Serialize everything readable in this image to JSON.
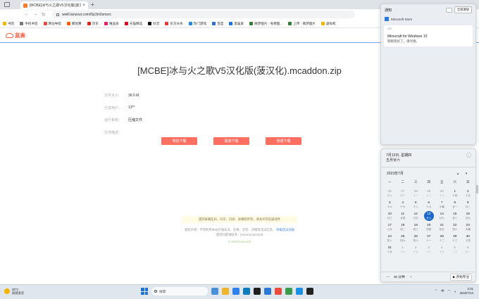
{
  "browser": {
    "tab_title": "[MCBE]冰与火之歌V5汉化版(菠汉化...",
    "tab_close": "×",
    "new_tab": "+",
    "url": "wwill.lanzout.com/i5p3m0smsrc",
    "back": "←",
    "forward": "→",
    "reload": "↻",
    "bookmarks": [
      {
        "label": "书签",
        "color": "#f4b400"
      },
      {
        "label": "手机书签",
        "color": "#777777"
      },
      {
        "label": "网址导航",
        "color": "#e84b3c"
      },
      {
        "label": "聚划算",
        "color": "#ff5a00"
      },
      {
        "label": "京东",
        "color": "#e1251b"
      },
      {
        "label": "唯品会",
        "color": "#e91e63"
      },
      {
        "label": "天猫精选",
        "color": "#d6001c"
      },
      {
        "label": "抖音",
        "color": "#111111"
      },
      {
        "label": "东方头条",
        "color": "#e53935"
      },
      {
        "label": "热门游戏",
        "color": "#1e88e5"
      },
      {
        "label": "百度",
        "color": "#2b6fd6"
      },
      {
        "label": "黑鲨屏",
        "color": "#1a73e8"
      },
      {
        "label": "微梦图片 · 免费图...",
        "color": "#2e7d32"
      },
      {
        "label": "上传 · 微梦图片",
        "color": "#2e7d32"
      },
      {
        "label": "虚拟机",
        "color": "#f4b400"
      }
    ]
  },
  "site": {
    "logo_text": "蓝奏",
    "file_title": "[MCBE]冰与火之歌V5汉化版(菠汉化).mcaddon.zip",
    "info": [
      {
        "label": "文件大小：",
        "value": "36.0 M"
      },
      {
        "label": "分享用户：",
        "value": "13**"
      },
      {
        "label": "运行系统：",
        "value": "压缩文件"
      },
      {
        "label": "文件描述：",
        "value": ""
      }
    ],
    "download_buttons": [
      "电信下载",
      "联通下载",
      "普通下载"
    ],
    "footer_note": "遇到屏幕乱码、闪页、白屏、屏幕假死等，请关闭浏览器插件",
    "footer_line1": "版权声明：不得利用本站存储非法、涉黄、涉恐、涉赌等违法信息。",
    "footer_link": "举报违法违规",
    "footer_line2": "遇到问题请联系：[email protected]",
    "copyright": "© 2023 Lanzou.li"
  },
  "notifications": {
    "title": "通知",
    "clear_all": "全部清除",
    "app": "Microsoft Store",
    "time": "1分",
    "card_title": "Minecraft for Windows 10",
    "card_body": "刚刚装好了，请尽情。"
  },
  "calendar": {
    "date_line1": "7月13日, 星期四",
    "date_line2": "五月廿六",
    "collapse": "⌄",
    "month": "2023年7月",
    "prev": "▲",
    "next": "▼",
    "weekdays": [
      "一",
      "二",
      "三",
      "四",
      "五",
      "六",
      "日"
    ],
    "weeks": [
      [
        {
          "d": "26",
          "s": "初九",
          "o": true
        },
        {
          "d": "27",
          "s": "初十",
          "o": true
        },
        {
          "d": "28",
          "s": "十一",
          "o": true
        },
        {
          "d": "29",
          "s": "十二",
          "o": true
        },
        {
          "d": "30",
          "s": "十三",
          "o": true
        },
        {
          "d": "1",
          "s": "十四"
        },
        {
          "d": "2",
          "s": "十五"
        }
      ],
      [
        {
          "d": "3",
          "s": "十六"
        },
        {
          "d": "4",
          "s": "十七"
        },
        {
          "d": "5",
          "s": "十八"
        },
        {
          "d": "6",
          "s": "十九"
        },
        {
          "d": "7",
          "s": "小暑"
        },
        {
          "d": "8",
          "s": "廿一"
        },
        {
          "d": "9",
          "s": "廿二"
        }
      ],
      [
        {
          "d": "10",
          "s": "廿三"
        },
        {
          "d": "11",
          "s": "廿四"
        },
        {
          "d": "12",
          "s": "廿五"
        },
        {
          "d": "13",
          "s": "廿六",
          "t": true
        },
        {
          "d": "14",
          "s": "廿七"
        },
        {
          "d": "15",
          "s": "廿八"
        },
        {
          "d": "16",
          "s": "廿九"
        }
      ],
      [
        {
          "d": "17",
          "s": "六月"
        },
        {
          "d": "18",
          "s": "初二"
        },
        {
          "d": "19",
          "s": "初三"
        },
        {
          "d": "20",
          "s": "初四"
        },
        {
          "d": "21",
          "s": "初五"
        },
        {
          "d": "22",
          "s": "初六"
        },
        {
          "d": "23",
          "s": "大暑"
        }
      ],
      [
        {
          "d": "24",
          "s": "初八"
        },
        {
          "d": "25",
          "s": "初九"
        },
        {
          "d": "26",
          "s": "初十"
        },
        {
          "d": "27",
          "s": "十一"
        },
        {
          "d": "28",
          "s": "十二"
        },
        {
          "d": "29",
          "s": "十三"
        },
        {
          "d": "30",
          "s": "十四"
        }
      ],
      [
        {
          "d": "31",
          "s": "十五"
        },
        {
          "d": "1",
          "s": "十六",
          "o": true
        },
        {
          "d": "2",
          "s": "十七",
          "o": true
        },
        {
          "d": "3",
          "s": "十八",
          "o": true
        },
        {
          "d": "4",
          "s": "十九",
          "o": true
        },
        {
          "d": "5",
          "s": "二十",
          "o": true
        },
        {
          "d": "6",
          "s": "廿一",
          "o": true
        }
      ]
    ],
    "focus_minus": "—",
    "focus_value": "30 分钟",
    "focus_plus": "+",
    "focus_button": "▶ 开始专注"
  },
  "taskbar": {
    "temp": "30°C",
    "weather": "局部多云",
    "search_placeholder": "搜索",
    "tray_up": "⌃",
    "tray_lang": "中",
    "time": "2:31",
    "date": "2023/7/13",
    "apps": [
      "#4a90d9",
      "#f0b429",
      "#2f80ed",
      "#0a7cbd",
      "#1e1e1e",
      "#2b78d8",
      "#e94b3c",
      "#3b9b4a",
      "#1a8fe3",
      "#222222"
    ]
  }
}
